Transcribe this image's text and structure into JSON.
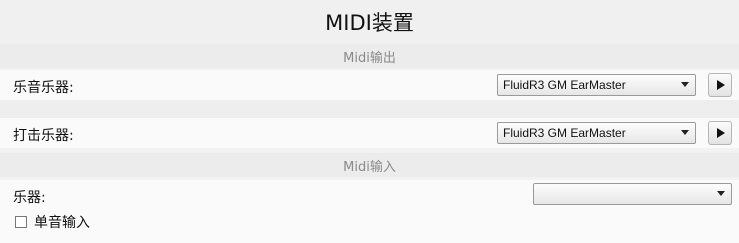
{
  "window": {
    "title": "MIDI装置"
  },
  "midi_output": {
    "header": "Midi输出",
    "rows": [
      {
        "label": "乐音乐器:",
        "selected": "FluidR3 GM EarMaster",
        "play_icon": "play-icon"
      },
      {
        "label": "打击乐器:",
        "selected": "FluidR3 GM EarMaster",
        "play_icon": "play-icon"
      }
    ]
  },
  "midi_input": {
    "header": "Midi输入",
    "instrument_label": "乐器:",
    "instrument_selected": "",
    "monophonic_label": "单音输入",
    "monophonic_checked": false
  }
}
